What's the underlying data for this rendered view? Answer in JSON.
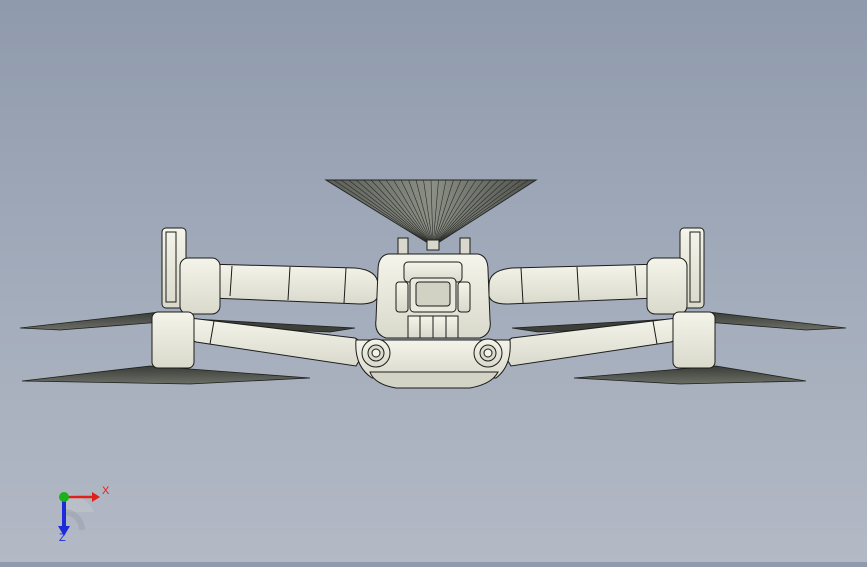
{
  "viewport": {
    "background_top": "#8f9aac",
    "background_bottom": "#b3b9c5",
    "model": "drone-assembly",
    "view": "front"
  },
  "triad": {
    "x_label": "X",
    "z_label": "Z",
    "x_color": "#e0201a",
    "y_color": "#18b21a",
    "z_color": "#1c2ad8"
  }
}
